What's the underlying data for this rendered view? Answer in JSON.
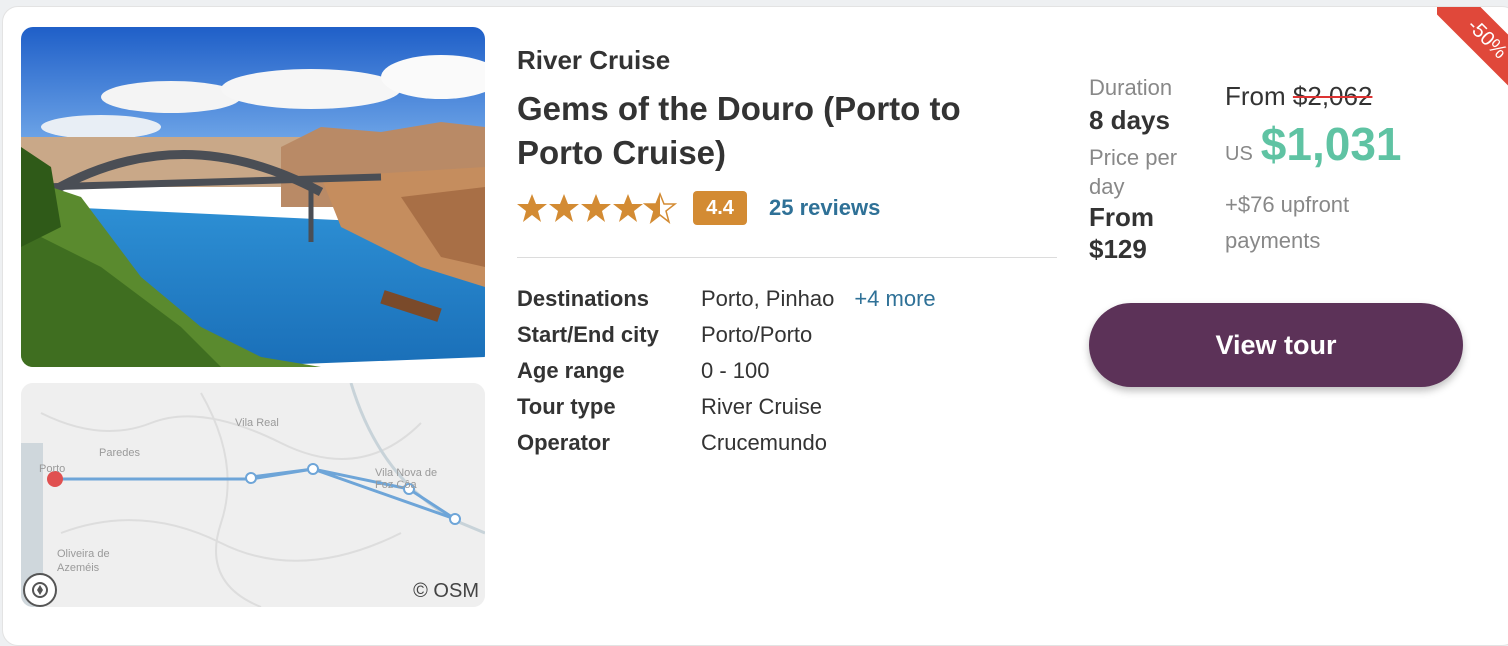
{
  "tour": {
    "category": "River Cruise",
    "title": "Gems of the Douro (Porto to Porto Cruise)",
    "rating": 4.4,
    "rating_label": "4.4",
    "reviews_label": "25 reviews",
    "discount_label": "-50%"
  },
  "details": [
    {
      "label": "Destinations",
      "value": "Porto, Pinhao",
      "more": "+4 more"
    },
    {
      "label": "Start/End city",
      "value": "Porto/Porto"
    },
    {
      "label": "Age range",
      "value": "0 - 100"
    },
    {
      "label": "Tour type",
      "value": "River Cruise"
    },
    {
      "label": "Operator",
      "value": "Crucemundo"
    }
  ],
  "pricing": {
    "duration_label": "Duration",
    "duration_value": "8 days",
    "ppd_label": "Price per day",
    "ppd_value": "From $129",
    "from_label": "From",
    "original_price": "$2,062",
    "currency": "US",
    "price": "$1,031",
    "upfront": "+$76 upfront payments"
  },
  "map": {
    "labels": [
      "Porto",
      "Paredes",
      "Vila Real",
      "Vila Nova de Foz Côa",
      "Oliveira de Azeméis"
    ],
    "attribution": "© OSM"
  },
  "actions": {
    "view_label": "View tour"
  },
  "colors": {
    "accent_button": "#5c3258",
    "price_green": "#5fc3a3",
    "link_blue": "#2f7197",
    "rating_orange": "#d38b33",
    "discount_red": "#e0483a"
  }
}
